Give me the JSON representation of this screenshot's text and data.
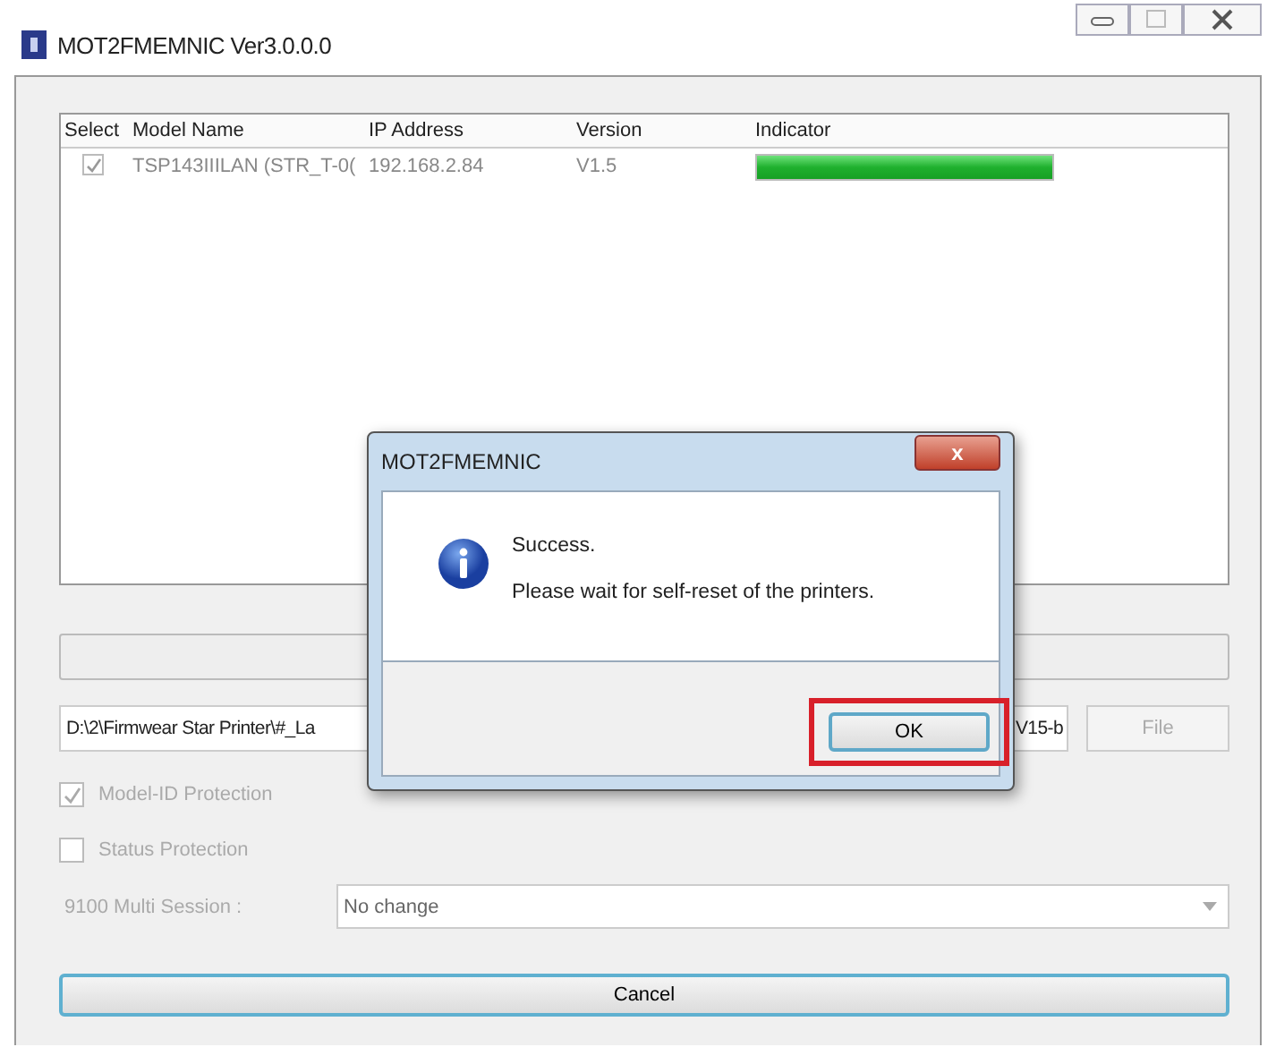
{
  "window": {
    "title": "MOT2FMEMNIC Ver3.0.0.0"
  },
  "table": {
    "columns": [
      "Select",
      "Model Name",
      "IP Address",
      "Version",
      "Indicator"
    ],
    "rows": [
      {
        "checked": true,
        "model": "TSP143IIILAN (STR_T-0(",
        "ip": "192.168.2.84",
        "version": "V1.5",
        "level": 1
      }
    ]
  },
  "path_field": {
    "value_start": "D:\\2\\Firmwear Star Printer\\#_La",
    "value_end": "V15-b"
  },
  "file_button": "File",
  "options": [
    {
      "label": "Model-ID Protection",
      "checked": true
    },
    {
      "label": "Status Protection",
      "checked": false
    }
  ],
  "session": {
    "label": "9100 Multi Session :",
    "value": "No change"
  },
  "cancel_button": "Cancel",
  "dialog": {
    "title": "MOT2FMEMNIC",
    "close": "x",
    "lines": [
      "Success.",
      "Please wait for self-reset of the printers."
    ],
    "ok_button": "OK",
    "highlighted": true
  }
}
